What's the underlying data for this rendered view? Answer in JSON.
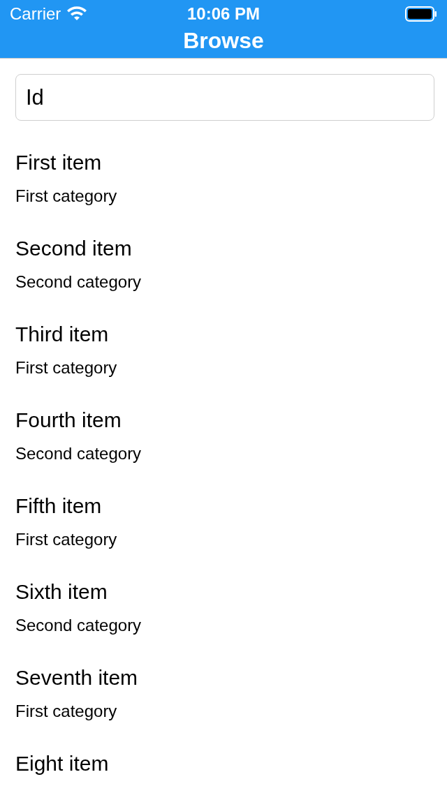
{
  "status_bar": {
    "carrier": "Carrier",
    "time": "10:06 PM"
  },
  "nav_bar": {
    "title": "Browse"
  },
  "search": {
    "value": "Id"
  },
  "items": [
    {
      "title": "First item",
      "category": "First category"
    },
    {
      "title": "Second item",
      "category": "Second category"
    },
    {
      "title": "Third item",
      "category": "First category"
    },
    {
      "title": "Fourth item",
      "category": "Second category"
    },
    {
      "title": "Fifth item",
      "category": "First category"
    },
    {
      "title": "Sixth item",
      "category": "Second category"
    },
    {
      "title": "Seventh item",
      "category": "First category"
    },
    {
      "title": "Eight item"
    }
  ]
}
